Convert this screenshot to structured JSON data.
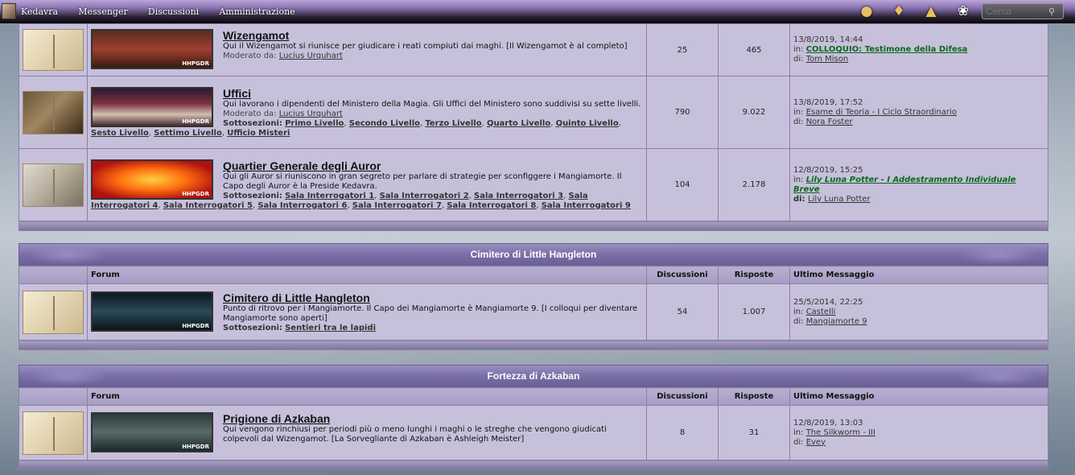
{
  "topbar": {
    "nav": [
      "Kedavra",
      "Messenger",
      "Discussioni",
      "Amministrazione"
    ],
    "icons": [
      "gold-icon",
      "treasure-icon",
      "hat-icon",
      "owl-icon"
    ],
    "search_placeholder": "Cerca"
  },
  "section1": {
    "rows": [
      {
        "title": "Wizengamot",
        "desc": "Qui il Wizengamot si riunisce per giudicare i reati compiuti dai maghi. [Il Wizengamot è al completo]",
        "mod_label": "Moderato da:",
        "mod": "Lucius Urquhart",
        "discussioni": "25",
        "risposte": "465",
        "last_date": "13/8/2019, 14:44",
        "last_in": "in:",
        "last_topic": "COLLOQUIO: Testimone della Difesa",
        "last_by_label": "di:",
        "last_by": "Tom Mison",
        "thumb_tag": "HHPGDR"
      },
      {
        "title": "Uffici",
        "desc": "Qui lavorano i dipendenti del Ministero della Magia. Gli Uffici del Ministero sono suddivisi su sette livelli.",
        "mod_label": "Moderato da:",
        "mod": "Lucius Urquhart",
        "sub_label": "Sottosezioni:",
        "subs": [
          "Primo Livello",
          "Secondo Livello",
          "Terzo Livello",
          "Quarto Livello",
          "Quinto Livello",
          "Sesto Livello",
          "Settimo Livello",
          "Ufficio Misteri"
        ],
        "discussioni": "790",
        "risposte": "9.022",
        "last_date": "13/8/2019, 17:52",
        "last_in": "in:",
        "last_topic": "Esame di Teoria - I Ciclo Straordinario",
        "last_by_label": "di:",
        "last_by": "Nora Foster",
        "thumb_tag": "HHPGDR"
      },
      {
        "title": "Quartier Generale degli Auror",
        "desc": "Qui gli Auror si riuniscono in gran segreto per parlare di strategie per sconfiggere i Mangiamorte. Il Capo degli Auror è la Preside Kedavra.",
        "sub_label": "Sottosezioni:",
        "subs": [
          "Sala Interrogatori 1",
          "Sala Interrogatori 2",
          "Sala Interrogatori 3",
          "Sala Interrogatori 4",
          "Sala Interrogatori 5",
          "Sala Interrogatori 6",
          "Sala Interrogatori 7",
          "Sala Interrogatori 8",
          "Sala Interrogatori 9"
        ],
        "discussioni": "104",
        "risposte": "2.178",
        "last_date": "12/8/2019, 15:25",
        "last_in": "in:",
        "last_topic": "Lily Luna Potter - I Addestramento Individuale Breve",
        "last_by_label": "di:",
        "last_by": "Lily Luna Potter",
        "thumb_tag": "HHPGDR"
      }
    ]
  },
  "cimitero": {
    "category": "Cimitero di Little Hangleton",
    "col_forum": "Forum",
    "col_disc": "Discussioni",
    "col_risp": "Risposte",
    "col_last": "Ultimo Messaggio",
    "row": {
      "title": "Cimitero di Little Hangleton",
      "desc": "Punto di ritrovo per i Mangiamorte. Il Capo dei Mangiamorte è Mangiamorte 9. [I colloqui per diventare Mangiamorte sono aperti]",
      "sub_label": "Sottosezioni:",
      "sub": "Sentieri tra le lapidi",
      "discussioni": "54",
      "risposte": "1.007",
      "last_date": "25/5/2014, 22:25",
      "last_in": "in:",
      "last_topic": "Castelli",
      "last_by_label": "di:",
      "last_by": "Mangiamorte 9",
      "thumb_tag": "HHPGDR"
    }
  },
  "azkaban": {
    "category": "Fortezza di Azkaban",
    "col_forum": "Forum",
    "col_disc": "Discussioni",
    "col_risp": "Risposte",
    "col_last": "Ultimo Messaggio",
    "row": {
      "title": "Prigione di Azkaban",
      "desc": "Qui vengono rinchiusi per periodi più o meno lunghi i maghi o le streghe che vengono giudicati colpevoli dal Wizengamot. [La Sorvegliante di Azkaban è Ashleigh Meister]",
      "discussioni": "8",
      "risposte": "31",
      "last_date": "12/8/2019, 13:03",
      "last_in": "in:",
      "last_topic": "The Silkworm - III",
      "last_by_label": "di:",
      "last_by": "Evey",
      "thumb_tag": "HHPGDR"
    }
  }
}
